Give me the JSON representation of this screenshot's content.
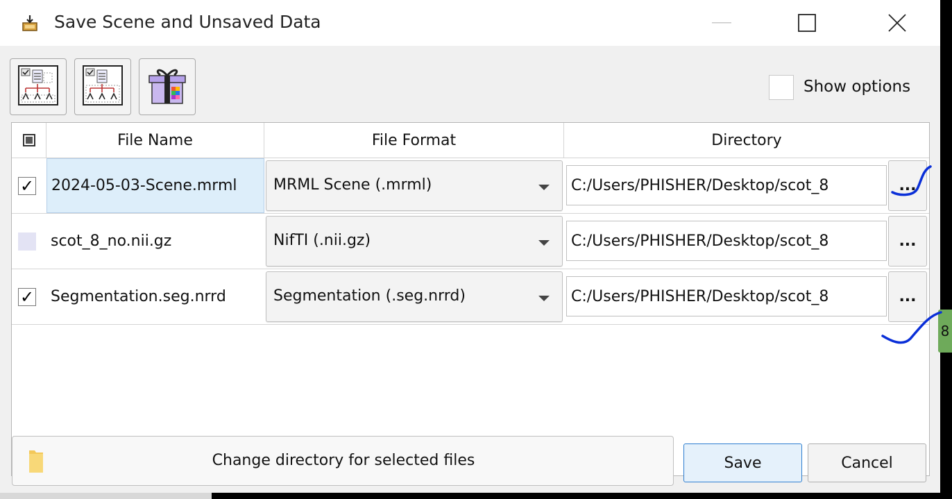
{
  "window": {
    "title": "Save Scene and Unsaved Data",
    "app_icon": "save-data-icon"
  },
  "toolbar": {
    "buttons": [
      {
        "icon": "select-modified-data-icon"
      },
      {
        "icon": "select-scene-data-icon"
      },
      {
        "icon": "data-bundle-icon"
      }
    ]
  },
  "options": {
    "show_options_label": "Show options",
    "show_options_checked": false
  },
  "table": {
    "headers": {
      "file_name": "File Name",
      "file_format": "File Format",
      "directory": "Directory"
    },
    "rows": [
      {
        "checked": true,
        "file_name": "2024-05-03-Scene.mrml",
        "format": "MRML Scene (.mrml)",
        "directory": "C:/Users/PHISHER/Desktop/scot_8",
        "browse": "..."
      },
      {
        "checked": false,
        "file_name": "scot_8_no.nii.gz",
        "format": "NifTI (.nii.gz)",
        "directory": "C:/Users/PHISHER/Desktop/scot_8",
        "browse": "..."
      },
      {
        "checked": true,
        "file_name": "Segmentation.seg.nrrd",
        "format": "Segmentation (.seg.nrrd)",
        "directory": "C:/Users/PHISHER/Desktop/scot_8",
        "browse": "..."
      }
    ]
  },
  "footer": {
    "change_directory_label": "Change directory for selected files",
    "save_label": "Save",
    "cancel_label": "Cancel"
  },
  "background": {
    "side_tab_text": "8"
  },
  "colors": {
    "accent": "#2d7ed0",
    "selection": "#ddeefa",
    "annotation_stroke": "#0a2fd8",
    "side_tab": "#6eaa5a"
  }
}
